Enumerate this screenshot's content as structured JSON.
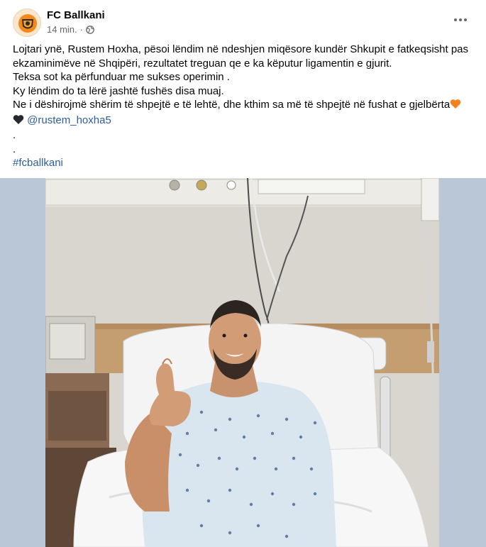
{
  "page": {
    "name": "FC Ballkani",
    "time": "14 min.",
    "separator": "·",
    "privacy_icon": "globe-icon",
    "more_icon": "more-options-icon",
    "avatar_icon": "fc-ballkani-crest"
  },
  "post": {
    "lines": [
      "Lojtari ynë, Rustem Hoxha, pësoi lëndim në ndeshjen miqësore kundër Shkupit e fatkeqsisht pas",
      "ekzaminimëve në Shqipëri, rezultatet treguan qe e ka këputur ligamentin e gjurit.",
      "Teksa sot ka përfunduar me sukses operimin .",
      "Ky lëndim do ta lërë jashtë fushës disa muaj.",
      "Ne i dëshirojmë shërim të shpejtë e të lehtë, dhe kthim sa më të shpejtë në fushat e gjelbërta"
    ],
    "emoji_orange_heart": "orange-heart-icon",
    "emoji_black_heart": "black-heart-icon",
    "mention": "@rustem_hoxha5",
    "dot_line_1": ".",
    "dot_line_2": ".",
    "hashtag": "#fcballkani"
  },
  "photo": {
    "alt": "player-in-hospital-bed-thumbs-up",
    "background_color": "#b9c7d6"
  }
}
